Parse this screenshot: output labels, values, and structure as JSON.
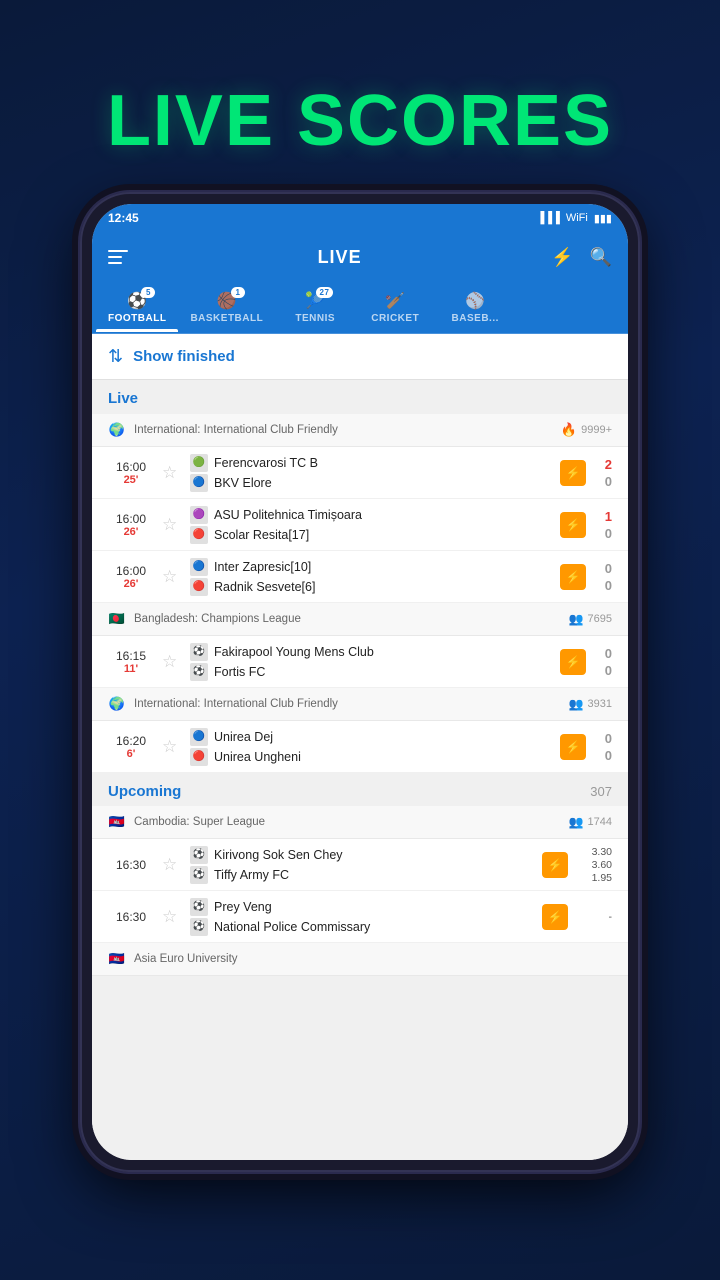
{
  "hero": {
    "title": "LIVE SCORES"
  },
  "statusBar": {
    "time": "12:45",
    "battery": "🔋",
    "signal": "📶"
  },
  "topBar": {
    "title": "LIVE",
    "filterIcon": "⚙",
    "searchIcon": "🔍"
  },
  "sportsTabs": [
    {
      "id": "football",
      "label": "FOOTBALL",
      "icon": "⚽",
      "badge": "5",
      "active": true
    },
    {
      "id": "basketball",
      "label": "BASKETBALL",
      "icon": "🏀",
      "badge": "1",
      "active": false
    },
    {
      "id": "tennis",
      "label": "TENNIS",
      "icon": "🎾",
      "badge": "27",
      "active": false
    },
    {
      "id": "cricket",
      "label": "CRICKET",
      "icon": "🏏",
      "badge": null,
      "active": false
    },
    {
      "id": "baseball",
      "label": "BASEB...",
      "icon": "⚾",
      "badge": null,
      "active": false
    }
  ],
  "showFinished": {
    "label": "Show finished"
  },
  "liveSection": {
    "title": "Live",
    "leagues": [
      {
        "flag": "🌍",
        "name": "International: International Club Friendly",
        "viewersIcon": "🔥",
        "viewers": "9999+",
        "type": "fire",
        "matches": [
          {
            "time": "16:00",
            "minute": "25'",
            "team1": "Ferencvarosi TC B",
            "team2": "BKV Elore",
            "score1": "2",
            "score2": "0",
            "scoreColor": "red"
          },
          {
            "time": "16:00",
            "minute": "26'",
            "team1": "ASU Politehnica Timișoara",
            "team2": "Scolar Resita[17]",
            "score1": "1",
            "score2": "0",
            "scoreColor": "red"
          },
          {
            "time": "16:00",
            "minute": "26'",
            "team1": "Inter Zapresic[10]",
            "team2": "Radnik Sesvete[6]",
            "score1": "0",
            "score2": "0",
            "scoreColor": "gray"
          }
        ]
      },
      {
        "flag": "🇧🇩",
        "name": "Bangladesh: Champions League",
        "viewersIcon": "👥",
        "viewers": "7695",
        "type": "viewers",
        "matches": [
          {
            "time": "16:15",
            "minute": "11'",
            "team1": "Fakirapool Young Mens Club",
            "team2": "Fortis FC",
            "score1": "0",
            "score2": "0",
            "scoreColor": "gray"
          }
        ]
      },
      {
        "flag": "🌍",
        "name": "International: International Club Friendly",
        "viewersIcon": "👥",
        "viewers": "3931",
        "type": "viewers",
        "matches": [
          {
            "time": "16:20",
            "minute": "6'",
            "team1": "Unirea Dej",
            "team2": "Unirea Ungheni",
            "score1": "0",
            "score2": "0",
            "scoreColor": "gray"
          }
        ]
      }
    ]
  },
  "upcomingSection": {
    "title": "Upcoming",
    "count": "307",
    "leagues": [
      {
        "flag": "🇰🇭",
        "name": "Cambodia: Super League",
        "viewersIcon": "👥",
        "viewers": "1744",
        "type": "viewers",
        "matches": [
          {
            "time": "16:30",
            "team1": "Kirivong Sok Sen Chey",
            "team2": "Tiffy Army FC",
            "odds1": "3.30",
            "oddsX": "3.60",
            "odds2": "1.95"
          },
          {
            "time": "16:30",
            "team1": "Prey Veng",
            "team2": "National Police Commissary",
            "odds1": "-",
            "oddsX": "-",
            "odds2": "-"
          }
        ]
      },
      {
        "flag": "🇰🇭",
        "name": "Asia Euro University",
        "viewersIcon": "👥",
        "viewers": "",
        "type": "viewers",
        "matches": []
      }
    ]
  }
}
